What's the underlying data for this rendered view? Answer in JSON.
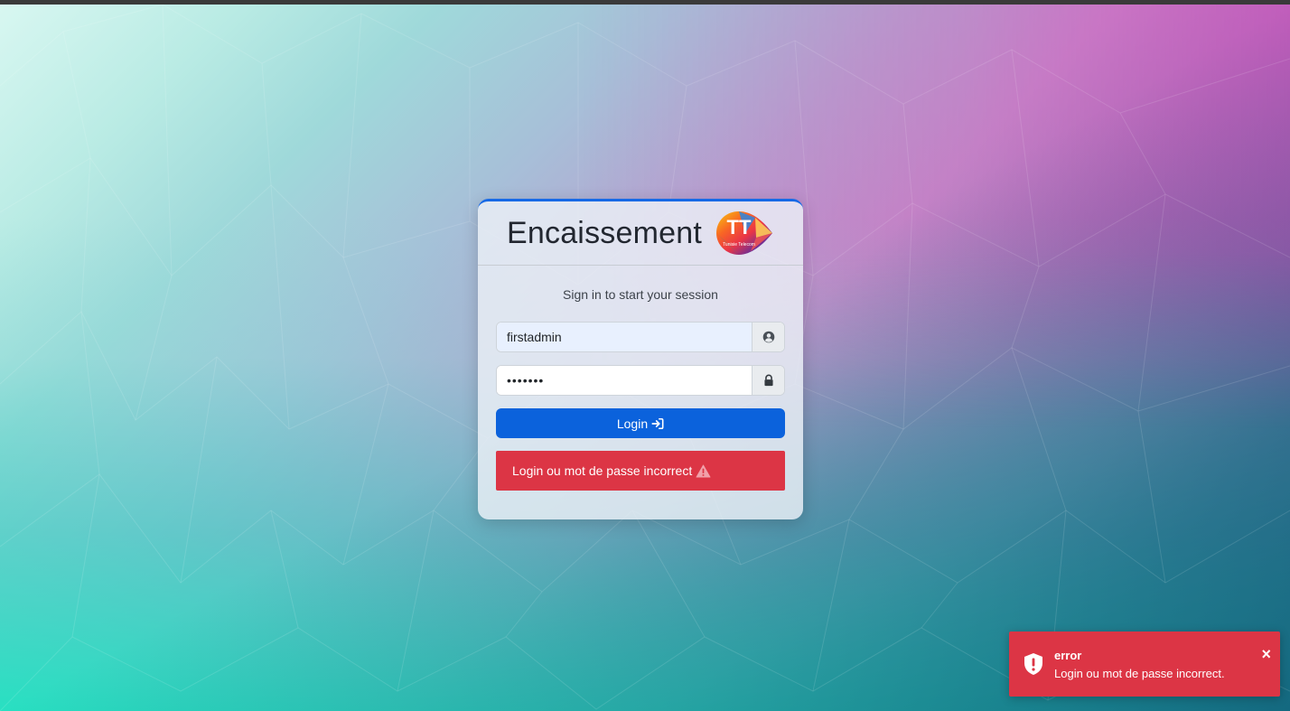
{
  "app": {
    "brand_title": "Encaissement",
    "logo_initials": "TT",
    "logo_caption": "Tunisie Telecom"
  },
  "login": {
    "subtitle": "Sign in to start your session",
    "username_value": "firstadmin",
    "password_value": "•••••••",
    "submit_label": "Login",
    "error_message": "Login ou mot de passe incorrect"
  },
  "toast": {
    "title": "error",
    "message": "Login ou mot de passe incorrect.",
    "close_symbol": "×"
  },
  "icons": {
    "user": "user-circle-icon",
    "lock": "lock-icon",
    "sign_in": "sign-in-icon",
    "warning": "warning-icon",
    "shield": "shield-icon",
    "close": "close-icon"
  },
  "colors": {
    "primary": "#0b62dc",
    "danger": "#dc3545",
    "card_border_top": "#1669e6"
  }
}
